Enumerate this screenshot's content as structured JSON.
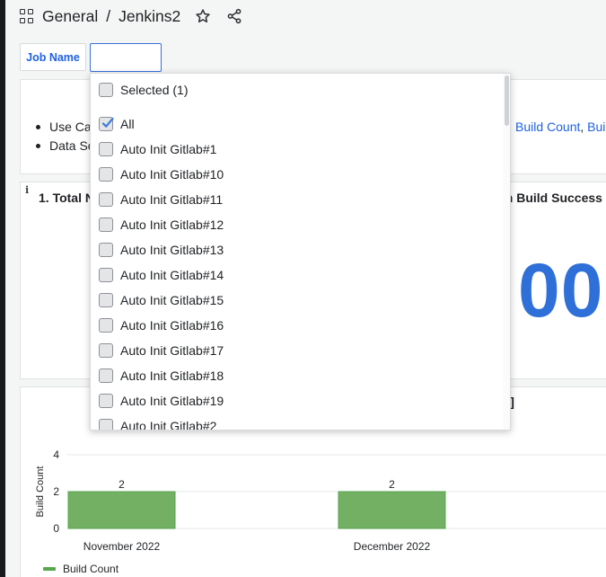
{
  "breadcrumb": {
    "folder": "General",
    "separator": "/",
    "dashboard": "Jenkins2"
  },
  "variables": {
    "job_name_label": "Job Name",
    "job_name_value": ""
  },
  "dropdown": {
    "selected_label": "Selected (1)",
    "options": [
      {
        "label": "All",
        "checked": true
      },
      {
        "label": "Auto Init Gitlab#1",
        "checked": false
      },
      {
        "label": "Auto Init Gitlab#10",
        "checked": false
      },
      {
        "label": "Auto Init Gitlab#11",
        "checked": false
      },
      {
        "label": "Auto Init Gitlab#12",
        "checked": false
      },
      {
        "label": "Auto Init Gitlab#13",
        "checked": false
      },
      {
        "label": "Auto Init Gitlab#14",
        "checked": false
      },
      {
        "label": "Auto Init Gitlab#15",
        "checked": false
      },
      {
        "label": "Auto Init Gitlab#16",
        "checked": false
      },
      {
        "label": "Auto Init Gitlab#17",
        "checked": false
      },
      {
        "label": "Auto Init Gitlab#18",
        "checked": false
      },
      {
        "label": "Auto Init Gitlab#19",
        "checked": false
      },
      {
        "label": "Auto Init Gitlab#2",
        "checked": false
      }
    ]
  },
  "text_panel": {
    "bullet1": "Use Ca",
    "bullet2": "Data So",
    "link1": "Build Count",
    "comma": ",",
    "link2": "Buil"
  },
  "stat_panel": {
    "info": "i",
    "title_left": "1. Total N",
    "title_right": "an Build Success",
    "value_fragment": "00"
  },
  "chart_panel": {
    "title_fragment": "th]"
  },
  "colors": {
    "accent": "#1f62e0",
    "stat_value": "#2e6fd8",
    "bar": "#73b064",
    "bar_border": "#56a64b"
  },
  "chart_data": {
    "type": "bar",
    "title": "",
    "xlabel": "",
    "ylabel": "Build Count",
    "ylim": [
      0,
      4
    ],
    "yticks": [
      "0",
      "2",
      "4"
    ],
    "grid": true,
    "legend": "bottom-left",
    "categories": [
      "November 2022",
      "December 2022"
    ],
    "series": [
      {
        "name": "Build Count",
        "values": [
          2,
          2
        ]
      }
    ],
    "data_labels": [
      "2",
      "2"
    ]
  }
}
